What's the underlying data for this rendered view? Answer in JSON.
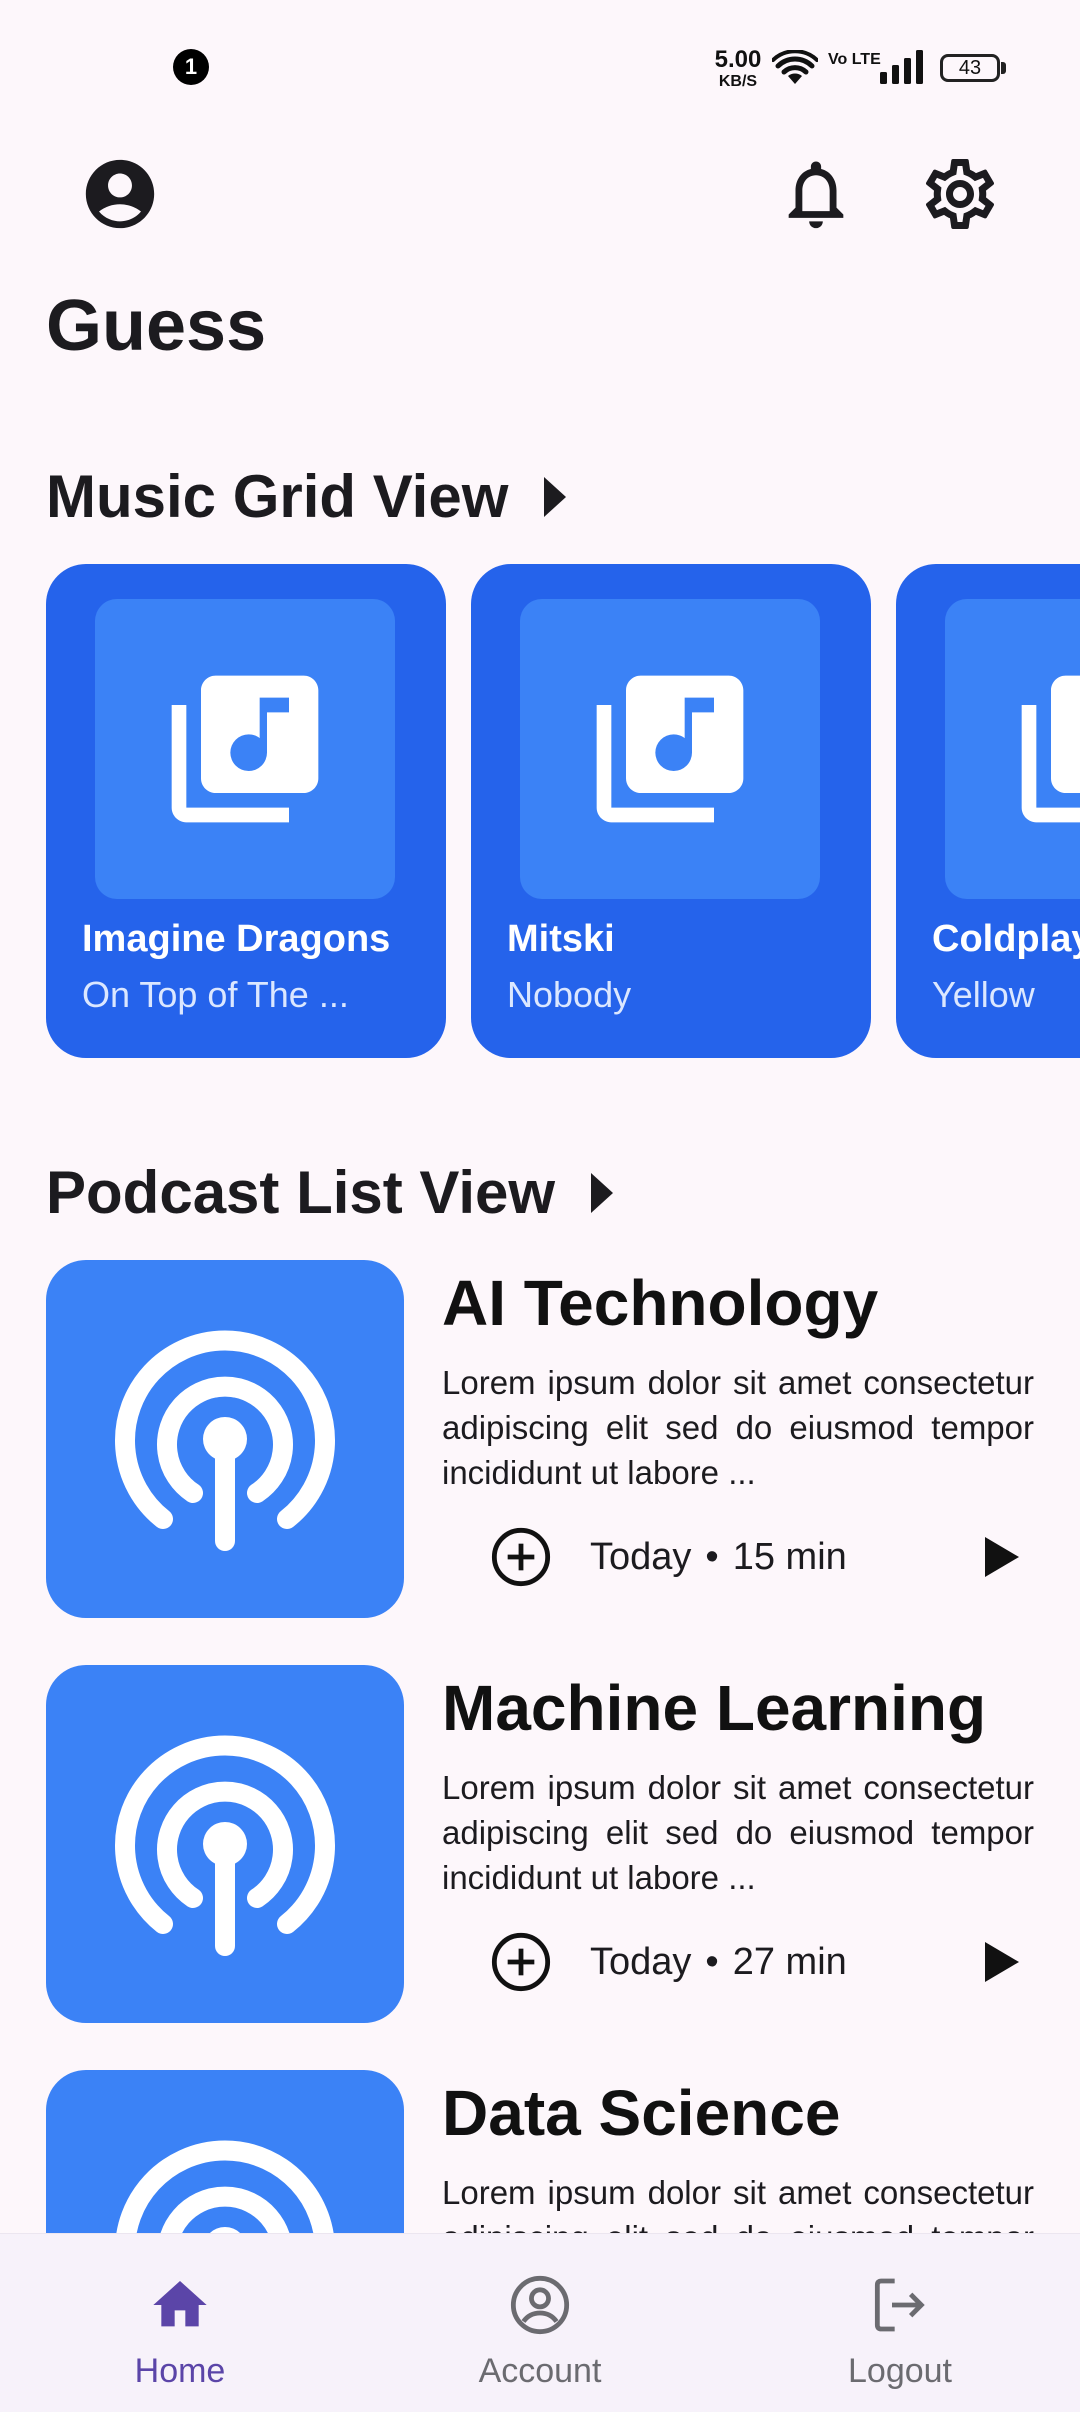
{
  "status_bar": {
    "notification_count": "1",
    "net_speed_value": "5.00",
    "net_speed_unit": "KB/S",
    "volte_label": "Vo LTE",
    "battery_level": "43"
  },
  "app_bar": {
    "profile_icon": "account-circle-icon",
    "notification_icon": "bell-icon",
    "settings_icon": "gear-icon"
  },
  "page": {
    "title": "Guess"
  },
  "music_section": {
    "title": "Music Grid View",
    "items": [
      {
        "artist": "Imagine Dragons",
        "song": "On Top of The ..."
      },
      {
        "artist": "Mitski",
        "song": "Nobody"
      },
      {
        "artist": "Coldplay",
        "song": "Yellow"
      }
    ]
  },
  "podcast_section": {
    "title": "Podcast List View",
    "items": [
      {
        "title": "AI Technology",
        "description": "Lorem ipsum dolor sit amet consectetur adipiscing elit sed do eiusmod tempor incididunt ut labore ...",
        "date": "Today",
        "duration": "15 min"
      },
      {
        "title": "Machine Learning",
        "description": "Lorem ipsum dolor sit amet consectetur adipiscing elit sed do eiusmod tempor incididunt ut labore ...",
        "date": "Today",
        "duration": "27 min"
      },
      {
        "title": "Data Science",
        "description": "Lorem ipsum dolor sit amet consectetur adipiscing elit sed do eiusmod tempor incididunt ut labore ...",
        "date": "",
        "duration": ""
      }
    ]
  },
  "bottom_nav": {
    "items": [
      {
        "label": "Home",
        "icon": "home-icon",
        "active": true
      },
      {
        "label": "Account",
        "icon": "account-circle-icon",
        "active": false
      },
      {
        "label": "Logout",
        "icon": "logout-icon",
        "active": false
      }
    ]
  },
  "colors": {
    "background": "#fdf7fb",
    "card_blue": "#2563eb",
    "art_blue": "#3b82f6",
    "nav_active": "#5b45a8"
  }
}
